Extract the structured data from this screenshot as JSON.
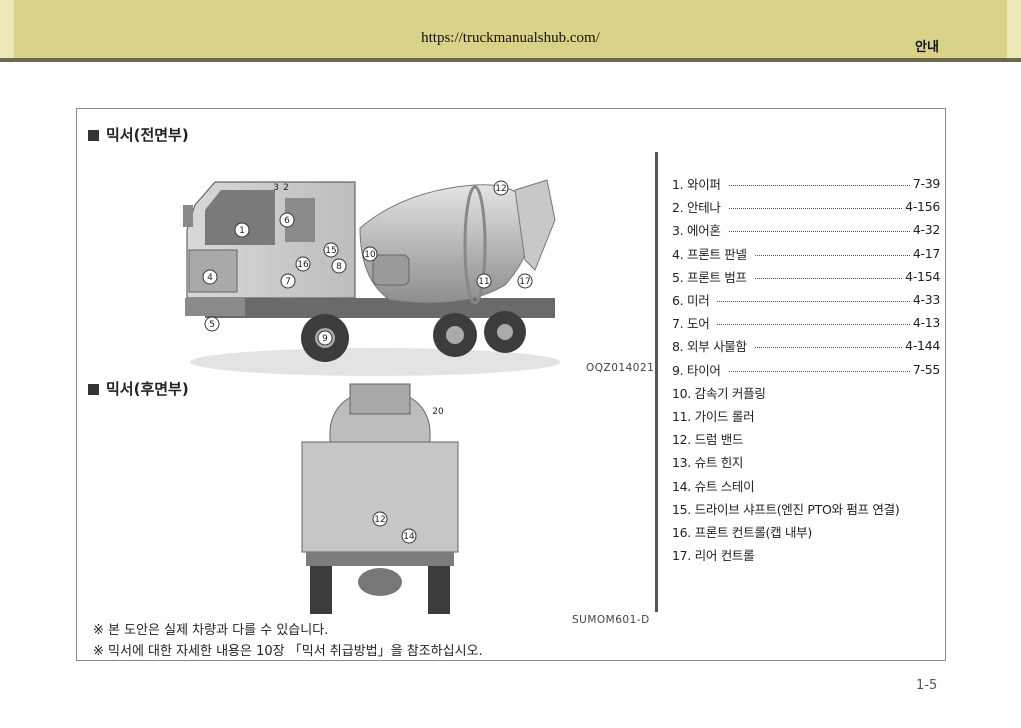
{
  "header": {
    "url": "https://truckmanualshub.com/",
    "section": "안내"
  },
  "front": {
    "title": "믹서(전면부)",
    "image_code": "OQZ014021",
    "callouts": [
      "3",
      "2",
      "12",
      "6",
      "1",
      "15",
      "16",
      "8",
      "10",
      "4",
      "7",
      "11",
      "17",
      "5",
      "9"
    ]
  },
  "rear": {
    "title": "믹서(후면부)",
    "image_code": "SUMOM601-D",
    "callouts": [
      "20",
      "12",
      "14"
    ]
  },
  "toc": [
    {
      "label": "1. 와이퍼",
      "page": "7-39"
    },
    {
      "label": "2. 안테나",
      "page": "4-156"
    },
    {
      "label": "3. 에어혼",
      "page": "4-32"
    },
    {
      "label": "4. 프론트 판넬",
      "page": "4-17"
    },
    {
      "label": "5. 프론트 범프",
      "page": "4-154"
    },
    {
      "label": "6. 미러",
      "page": "4-33"
    },
    {
      "label": "7. 도어",
      "page": "4-13"
    },
    {
      "label": "8. 외부 사물함",
      "page": "4-144"
    },
    {
      "label": "9. 타이어",
      "page": "7-55"
    },
    {
      "label": "10. 감속기 커플링",
      "page": ""
    },
    {
      "label": "11. 가이드 롤러",
      "page": ""
    },
    {
      "label": "12. 드럼 밴드",
      "page": ""
    },
    {
      "label": "13. 슈트 힌지",
      "page": ""
    },
    {
      "label": "14. 슈트 스테이",
      "page": ""
    },
    {
      "label": "15. 드라이브 샤프트(엔진 PTO와 펌프 연결)",
      "page": ""
    },
    {
      "label": "16. 프론트 컨트롤(캡 내부)",
      "page": ""
    },
    {
      "label": "17. 리어 컨트롤",
      "page": ""
    }
  ],
  "notes": [
    "※ 본 도안은 실제 차량과 다를 수 있습니다.",
    "※ 믹서에 대한 자세한 내용은 10장 「믹서 취급방법」을 참조하십시오."
  ],
  "page_number": "1-5"
}
